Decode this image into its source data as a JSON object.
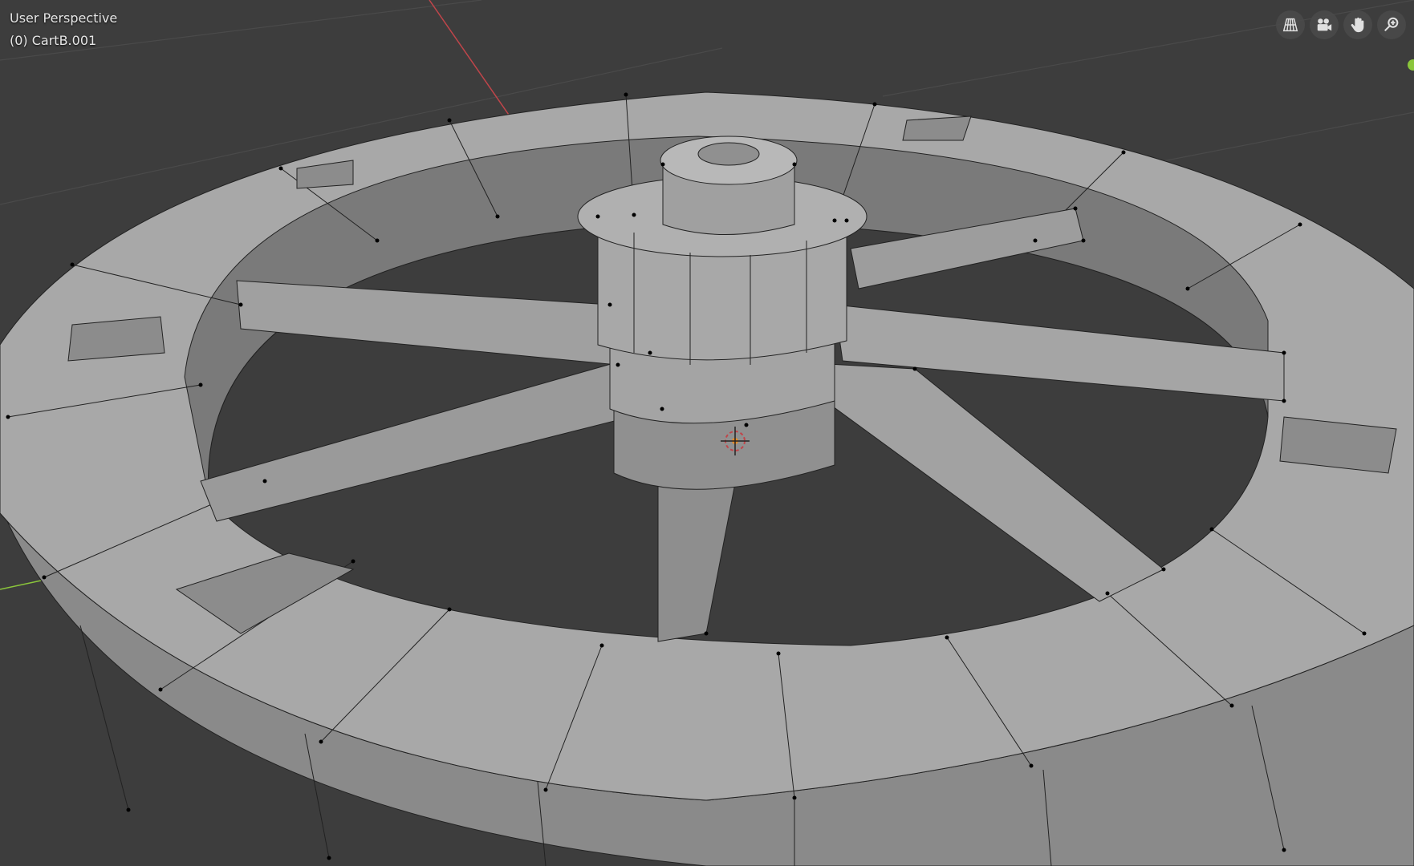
{
  "viewport": {
    "view_name": "User Perspective",
    "object_label": "(0) CartB.001"
  },
  "nav_gizmo": {
    "items": [
      {
        "name": "toggle-ortho-icon"
      },
      {
        "name": "camera-view-icon"
      },
      {
        "name": "pan-hand-icon"
      },
      {
        "name": "zoom-magnifier-icon"
      }
    ]
  },
  "colors": {
    "background": "#3d3d3d",
    "mesh_light": "#a9a9a9",
    "mesh_mid": "#8f8f8f",
    "mesh_dark": "#6b6b6b",
    "x_axis": "#c0454a",
    "y_axis": "#8bc63b",
    "vertex": "#000000"
  }
}
